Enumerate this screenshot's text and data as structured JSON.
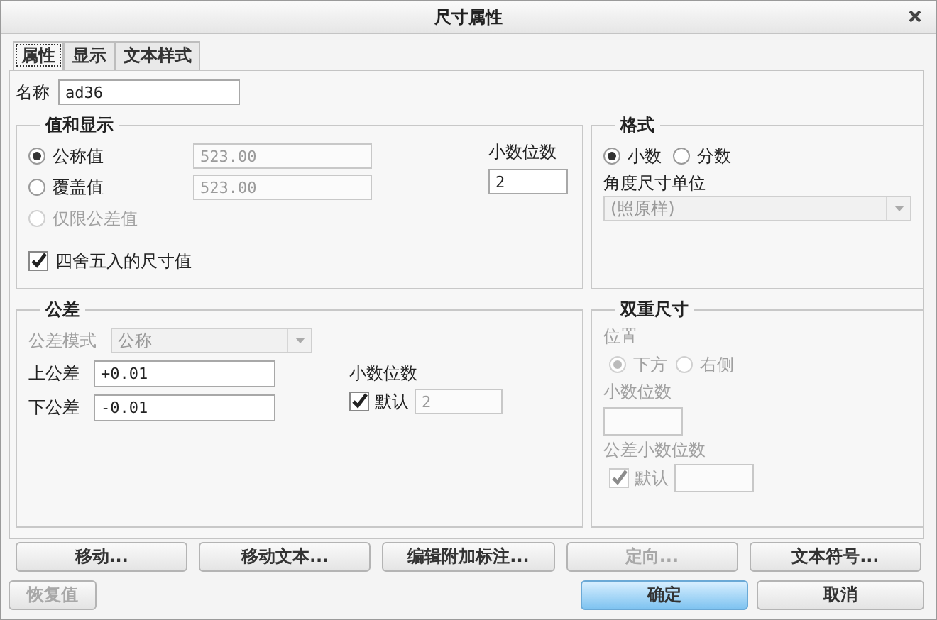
{
  "window": {
    "title": "尺寸属性"
  },
  "tabs": [
    {
      "label": "属性",
      "selected": true
    },
    {
      "label": "显示",
      "selected": false
    },
    {
      "label": "文本样式",
      "selected": false
    }
  ],
  "name": {
    "label": "名称",
    "value": "ad36"
  },
  "value_display": {
    "title": "值和显示",
    "radios": [
      {
        "label": "公称值",
        "selected": true,
        "disabled": false,
        "value": "523.00"
      },
      {
        "label": "覆盖值",
        "selected": false,
        "disabled": false,
        "value": "523.00"
      },
      {
        "label": "仅限公差值",
        "selected": false,
        "disabled": true
      }
    ],
    "decimals": {
      "label": "小数位数",
      "value": "2"
    },
    "round": {
      "label": "四舍五入的尺寸值",
      "checked": true
    }
  },
  "format": {
    "title": "格式",
    "radios": [
      {
        "label": "小数",
        "selected": true,
        "disabled": false
      },
      {
        "label": "分数",
        "selected": false,
        "disabled": false
      }
    ],
    "angle_unit": {
      "label": "角度尺寸单位",
      "value": "(照原样)",
      "disabled": true
    }
  },
  "tolerance": {
    "title": "公差",
    "mode": {
      "label": "公差模式",
      "value": "公称",
      "disabled": true
    },
    "upper": {
      "label": "上公差",
      "value": "+0.01"
    },
    "lower": {
      "label": "下公差",
      "value": "-0.01"
    },
    "decimals": {
      "label": "小数位数",
      "default_label": "默认",
      "checked": true,
      "value": "2"
    }
  },
  "dual": {
    "title": "双重尺寸",
    "position": {
      "label": "位置",
      "radios": [
        {
          "label": "下方",
          "selected": true,
          "disabled": true
        },
        {
          "label": "右侧",
          "selected": false,
          "disabled": true
        }
      ]
    },
    "decimals": {
      "label": "小数位数"
    },
    "tol_decimals": {
      "label": "公差小数位数",
      "default_label": "默认",
      "checked": true,
      "disabled": true
    }
  },
  "buttons": [
    {
      "label": "移动...",
      "disabled": false
    },
    {
      "label": "移动文本...",
      "disabled": false
    },
    {
      "label": "编辑附加标注...",
      "disabled": false
    },
    {
      "label": "定向...",
      "disabled": true
    },
    {
      "label": "文本符号...",
      "disabled": false
    }
  ],
  "footer": {
    "restore": {
      "label": "恢复值",
      "disabled": true
    },
    "ok": {
      "label": "确定"
    },
    "cancel": {
      "label": "取消"
    }
  }
}
